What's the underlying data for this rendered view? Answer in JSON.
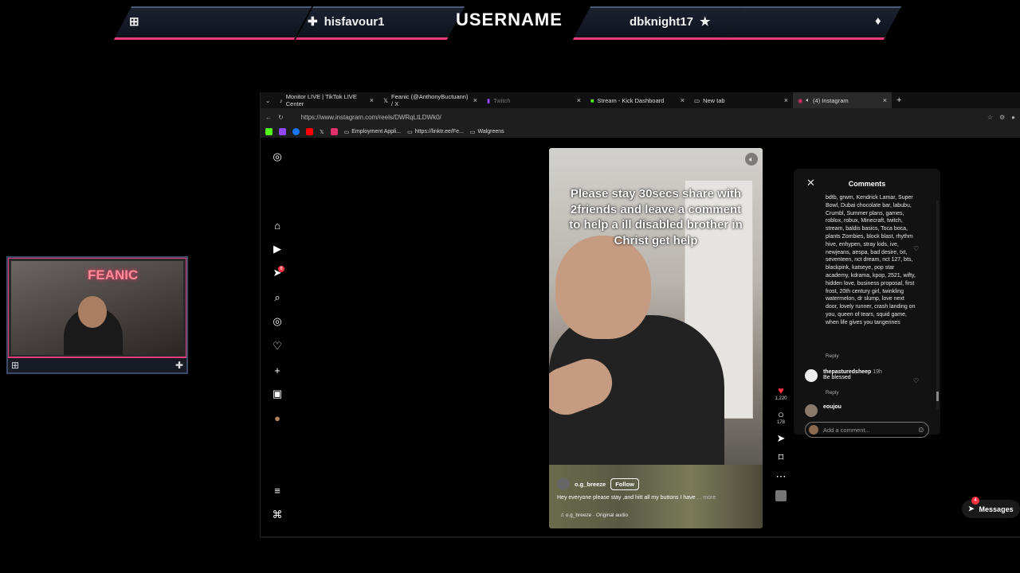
{
  "overlay": {
    "title": "USERNAME",
    "left_user": "hisfavour1",
    "right_user": "dbknight17",
    "colors": {
      "accent": "#e83a7a",
      "frame": "#4a5a78"
    }
  },
  "browser": {
    "tabs": [
      {
        "label": "Monitor LIVE | TikTok LIVE Center",
        "icon": "tiktok-icon"
      },
      {
        "label": "Feanic (@AnthonyBuctuann) / X",
        "icon": "x-icon"
      },
      {
        "label": "Twitch",
        "icon": "twitch-icon"
      },
      {
        "label": "Stream - Kick Dashboard",
        "icon": "kick-icon"
      },
      {
        "label": "New tab",
        "icon": "page-icon"
      },
      {
        "label": "(4) Instagram",
        "icon": "instagram-icon"
      }
    ],
    "url": "https://www.instagram.com/reels/DWRqLtLDWk0/",
    "bookmarks": [
      "Employment Appli...",
      "https://linktr.ee/Fe...",
      "Walgreens"
    ]
  },
  "instagram": {
    "sidebar_badge": "6",
    "reel": {
      "caption": "Please stay 30secs share with 2friends and leave a comment to help a ill disabled brother in Christ get help",
      "username": "o.g_breeze",
      "follow_label": "Follow",
      "description": "Hey everyone please stay ,and hitt all my buttons I have",
      "more_label": "... more",
      "audio": "o.g_breeze · Original audio"
    },
    "actions": {
      "likes": "1,220",
      "comments": "178"
    },
    "comments": {
      "title": "Comments",
      "body": "bdtb, grwm, Kendrick Lamar, Super Bowl, Dubai chocolate bar, labubu, Crumbl, Summer plans, games, roblox, robux, Minecraft, twitch, stream, baldis basics, Toca boca, plants Zombies, block blast, rhythm hive, enhypen, stray kids, ive, newjeans, aespa, bad desire, txt, seventeen, nct dream, nct 127, bts, blackpink, katseye, pop star academy, kdrama, kpop, 2521, wifty, hidden love, business proposal, first frost, 20th century girl, twinkling watermelon, dr slump, love next door, lovely runner, crash landing on you, queen of tears, squid game, when life gives you tangerines",
      "reply_label": "Reply",
      "second_user": "thepasturedsheep",
      "second_time": "19h",
      "second_text": "Be blessed",
      "third_user": "eoujou",
      "input_placeholder": "Add a comment..."
    },
    "messages": {
      "label": "Messages",
      "badge": "4"
    }
  }
}
